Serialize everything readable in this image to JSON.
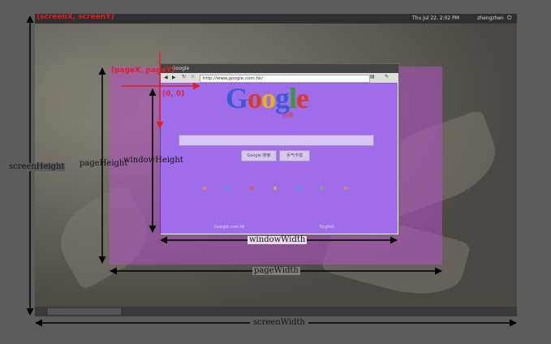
{
  "top_panel": {
    "clock": "Thu Jul 22, 2:02 PM",
    "user": "zhengzhen"
  },
  "browser": {
    "tab_title": "Google",
    "url": "http://www.google.com.hk/"
  },
  "google_page": {
    "logo_letters": [
      "G",
      "o",
      "o",
      "g",
      "l",
      "e"
    ],
    "logo_colors": [
      "#3b5bd6",
      "#d83a2a",
      "#e9b215",
      "#3b5bd6",
      "#3a9a3a",
      "#d83a2a"
    ],
    "logo_subtitle": "谷歌",
    "buttons": [
      "Google 搜索",
      "手气不错"
    ],
    "footer": [
      "Google.com.hk",
      "English"
    ]
  },
  "labels": {
    "screen_xy": "(screenX, screenY)",
    "page_xy": "(pageX, pageY)",
    "origin": "(0, 0)",
    "screen_height": "screenHeight",
    "page_height": "pageHeight",
    "window_height": "windowHeight",
    "window_width": "windowWidth",
    "page_width": "pageWidth",
    "screen_width": "screenWidth"
  },
  "colors": {
    "page_overlay": "#b450c8",
    "window_overlay": "#6414dc",
    "annotation_red": "#e02020",
    "arrow_black": "#000000"
  }
}
